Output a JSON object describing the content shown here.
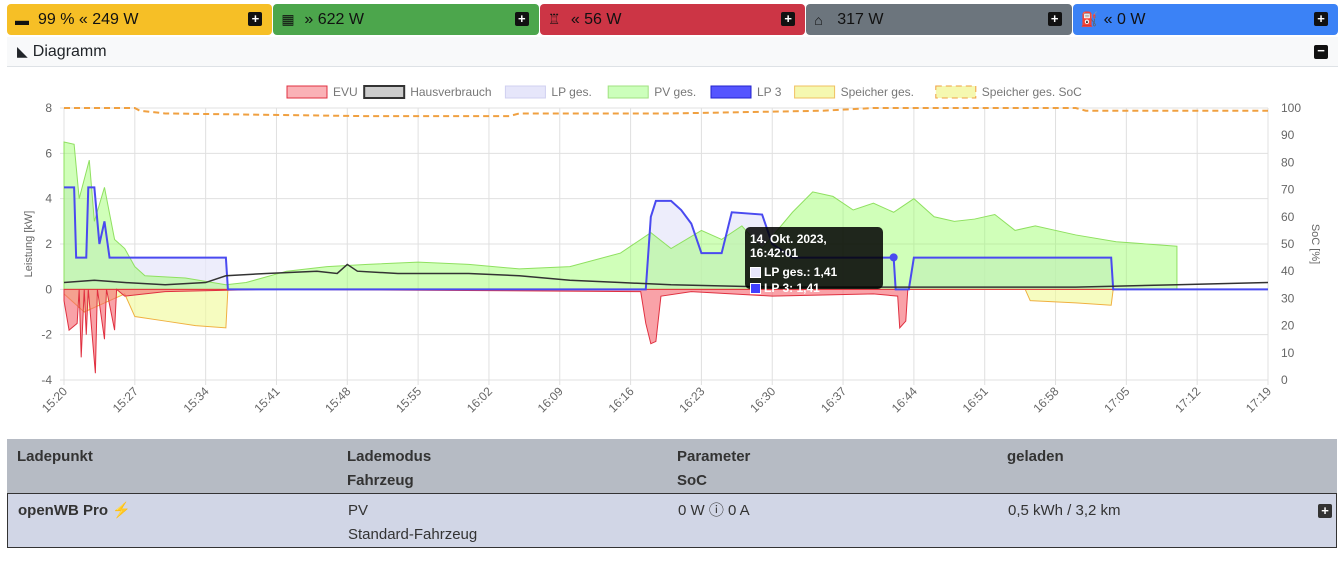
{
  "topbar": [
    {
      "icon": "battery-icon",
      "glyph": "▬",
      "text": "99 % « 249 W",
      "bg": "#f6bf26",
      "fg": "#111"
    },
    {
      "icon": "solar-panel-icon",
      "glyph": "▦",
      "text": "» 622 W",
      "bg": "#4ca64c",
      "fg": "#111"
    },
    {
      "icon": "power-pylon-icon",
      "glyph": "♖",
      "text": "« 56 W",
      "bg": "#cc3545",
      "fg": "#111"
    },
    {
      "icon": "house-icon",
      "glyph": "⌂",
      "text": "317 W",
      "bg": "#6c757d",
      "fg": "#111"
    },
    {
      "icon": "charging-station-icon",
      "glyph": "⛽",
      "text": "« 0 W",
      "bg": "#3b82f6",
      "fg": "#111"
    }
  ],
  "diagram": {
    "title": "Diagramm"
  },
  "chart_data": {
    "type": "area",
    "legend": [
      "EVU",
      "Hausverbrauch",
      "LP ges.",
      "PV ges.",
      "LP 3",
      "Speicher ges.",
      "Speicher ges. SoC"
    ],
    "legend_position": "top",
    "ylabel": "Leistung [kW]",
    "y2label": "SoC [%]",
    "ylim": [
      -4,
      8
    ],
    "y2lim": [
      0,
      100
    ],
    "yticks": [
      "8",
      "6",
      "4",
      "2",
      "0",
      "-2",
      "-4"
    ],
    "y2ticks": [
      "100",
      "90",
      "80",
      "70",
      "60",
      "50",
      "40",
      "30",
      "20",
      "10",
      "0"
    ],
    "xticks": [
      "15:20",
      "15:27",
      "15:34",
      "15:41",
      "15:48",
      "15:55",
      "16:02",
      "16:09",
      "16:16",
      "16:23",
      "16:30",
      "16:37",
      "16:44",
      "16:51",
      "16:58",
      "17:05",
      "17:12",
      "17:19"
    ],
    "x_unit": "minutes since 15:20",
    "xlim": [
      0,
      119
    ],
    "series": {
      "pv": [
        [
          0,
          6.5
        ],
        [
          1,
          6.4
        ],
        [
          1.5,
          4
        ],
        [
          2.5,
          5.7
        ],
        [
          3,
          3
        ],
        [
          4,
          4.5
        ],
        [
          5,
          2.2
        ],
        [
          6,
          1.8
        ],
        [
          7,
          1
        ],
        [
          8,
          0.6
        ],
        [
          12,
          0.5
        ],
        [
          16,
          0.2
        ],
        [
          18,
          0.3
        ],
        [
          22,
          0.8
        ],
        [
          26,
          1
        ],
        [
          30,
          1.1
        ],
        [
          35,
          1.2
        ],
        [
          40,
          1.1
        ],
        [
          45,
          0.9
        ],
        [
          50,
          1
        ],
        [
          55,
          1.6
        ],
        [
          58,
          2.5
        ],
        [
          60,
          1.8
        ],
        [
          63,
          2.6
        ],
        [
          65,
          2.2
        ],
        [
          67,
          2.8
        ],
        [
          69,
          1.8
        ],
        [
          72,
          3.4
        ],
        [
          74,
          4.3
        ],
        [
          76,
          4.1
        ],
        [
          78,
          3.5
        ],
        [
          80,
          3.8
        ],
        [
          82,
          3.4
        ],
        [
          84,
          4
        ],
        [
          86,
          3.2
        ],
        [
          88,
          3
        ],
        [
          90,
          3.1
        ],
        [
          92,
          3.3
        ],
        [
          94,
          2.6
        ],
        [
          96,
          2.8
        ],
        [
          100,
          2.4
        ],
        [
          104,
          2.1
        ],
        [
          110,
          1.9
        ],
        [
          120,
          1.4
        ],
        [
          130,
          1.2
        ],
        [
          140,
          0.9
        ],
        [
          150,
          0.8
        ],
        [
          160,
          0.6
        ],
        [
          170,
          0.5
        ],
        [
          180,
          0.5
        ]
      ],
      "lp3": [
        [
          0,
          4.5
        ],
        [
          1,
          4.5
        ],
        [
          1.2,
          1.4
        ],
        [
          2.2,
          1.4
        ],
        [
          2.4,
          4.5
        ],
        [
          3,
          4.5
        ],
        [
          3.5,
          2
        ],
        [
          4,
          3
        ],
        [
          4.5,
          1.4
        ],
        [
          16,
          1.4
        ],
        [
          16.2,
          0
        ],
        [
          57.5,
          0
        ],
        [
          58,
          3.2
        ],
        [
          58.5,
          3.9
        ],
        [
          60,
          3.9
        ],
        [
          61,
          3.5
        ],
        [
          62,
          2.9
        ],
        [
          63,
          1.6
        ],
        [
          65,
          1.6
        ],
        [
          66,
          3.4
        ],
        [
          69,
          3.3
        ],
        [
          70,
          2
        ],
        [
          72,
          1.4
        ],
        [
          82,
          1.4
        ],
        [
          82.2,
          0
        ],
        [
          83.5,
          0
        ],
        [
          84,
          1.4
        ],
        [
          103.5,
          1.4
        ],
        [
          103.7,
          0
        ],
        [
          119,
          0
        ]
      ],
      "haus": [
        [
          0,
          0.3
        ],
        [
          3,
          0.4
        ],
        [
          6,
          0.3
        ],
        [
          10,
          0.2
        ],
        [
          14,
          0.3
        ],
        [
          16,
          0.6
        ],
        [
          20,
          0.7
        ],
        [
          25,
          0.8
        ],
        [
          27,
          0.7
        ],
        [
          28,
          1.1
        ],
        [
          29,
          0.8
        ],
        [
          33,
          0.7
        ],
        [
          40,
          0.7
        ],
        [
          45,
          0.6
        ],
        [
          50,
          0.4
        ],
        [
          55,
          0.3
        ],
        [
          60,
          0.2
        ],
        [
          70,
          0.1
        ],
        [
          80,
          0.1
        ],
        [
          90,
          0.1
        ],
        [
          100,
          0.1
        ],
        [
          110,
          0.2
        ],
        [
          119,
          0.3
        ]
      ],
      "evu": [
        [
          0,
          -0.5
        ],
        [
          0.5,
          -1.8
        ],
        [
          1.3,
          -1.5
        ],
        [
          1.5,
          0
        ],
        [
          1.7,
          -3
        ],
        [
          2,
          0
        ],
        [
          2.2,
          -2
        ],
        [
          2.4,
          0
        ],
        [
          3.1,
          -3.7
        ],
        [
          3.3,
          0
        ],
        [
          4,
          -2.2
        ],
        [
          4.2,
          0
        ],
        [
          5,
          -1.8
        ],
        [
          5.2,
          0
        ],
        [
          6,
          -0.3
        ],
        [
          10,
          -0.1
        ],
        [
          20,
          0
        ],
        [
          57,
          -0.1
        ],
        [
          57.5,
          -1.5
        ],
        [
          58,
          -2.4
        ],
        [
          58.5,
          -2.3
        ],
        [
          59,
          -0.3
        ],
        [
          62,
          -0.1
        ],
        [
          70,
          -0.3
        ],
        [
          80,
          -0.2
        ],
        [
          82.4,
          -0.3
        ],
        [
          82.6,
          -1.7
        ],
        [
          83.2,
          -1.4
        ],
        [
          83.4,
          0
        ],
        [
          119,
          0
        ]
      ],
      "speicher": [
        [
          0,
          -0.2
        ],
        [
          2,
          -1
        ],
        [
          4,
          -0.6
        ],
        [
          6,
          -0.2
        ],
        [
          7,
          -1.2
        ],
        [
          10,
          -1.4
        ],
        [
          13,
          -1.6
        ],
        [
          16,
          -1.7
        ],
        [
          16.2,
          0
        ],
        [
          95,
          0
        ],
        [
          95.5,
          -0.5
        ],
        [
          100,
          -0.6
        ],
        [
          103.5,
          -0.7
        ],
        [
          103.7,
          0
        ],
        [
          119,
          0
        ]
      ],
      "soc": [
        [
          0,
          100
        ],
        [
          7,
          100
        ],
        [
          7.5,
          99
        ],
        [
          10,
          98
        ],
        [
          30,
          97
        ],
        [
          44,
          97
        ],
        [
          45,
          98
        ],
        [
          60,
          98
        ],
        [
          75,
          99
        ],
        [
          80,
          100
        ],
        [
          100,
          100
        ],
        [
          101,
          99
        ],
        [
          119,
          99
        ]
      ]
    },
    "tooltip": {
      "title": "14. Okt. 2023, 16:42:01",
      "rows": [
        "LP ges.: 1,41",
        "LP 3: 1,41"
      ]
    }
  },
  "table": {
    "headers": [
      [
        "Ladepunkt",
        ""
      ],
      [
        "Lademodus",
        "Fahrzeug"
      ],
      [
        "Parameter",
        "SoC"
      ],
      [
        "geladen",
        ""
      ]
    ],
    "row": {
      "name": "openWB Pro",
      "mode": "PV",
      "vehicle": "Standard-Fahrzeug",
      "params": "0 W ⓘ 0 A",
      "charged": "0,5 kWh / 3,2 km"
    }
  }
}
